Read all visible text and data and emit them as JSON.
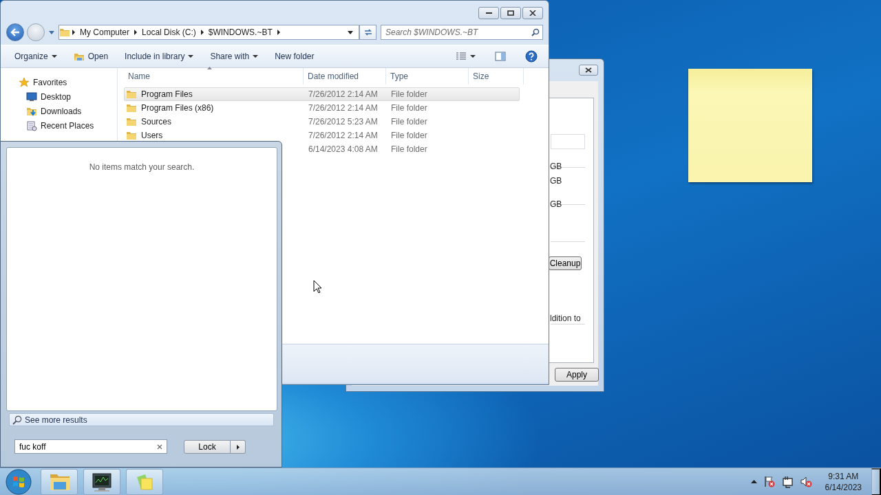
{
  "explorer": {
    "breadcrumb": [
      "My Computer",
      "Local Disk (C:)",
      "$WINDOWS.~BT"
    ],
    "search": {
      "placeholder": "Search $WINDOWS.~BT"
    },
    "toolbar": [
      {
        "label": "Organize",
        "kind": "menu"
      },
      {
        "label": "Open",
        "kind": "open"
      },
      {
        "label": "Include in library",
        "kind": "menu"
      },
      {
        "label": "Share with",
        "kind": "menu"
      },
      {
        "label": "New folder",
        "kind": "plain"
      }
    ],
    "nav": [
      {
        "label": "Favorites",
        "kind": "star",
        "children": [
          {
            "label": "Desktop",
            "kind": "desktop"
          },
          {
            "label": "Downloads",
            "kind": "downloads"
          },
          {
            "label": "Recent Places",
            "kind": "recent"
          }
        ]
      }
    ],
    "columns": [
      "Name",
      "Date modified",
      "Type",
      "Size"
    ],
    "rows": [
      {
        "name": "Program Files",
        "date": "7/26/2012 2:14 AM",
        "type": "File folder",
        "selected": true
      },
      {
        "name": "Program Files (x86)",
        "date": "7/26/2012 2:14 AM",
        "type": "File folder",
        "selected": false
      },
      {
        "name": "Sources",
        "date": "7/26/2012 5:23 AM",
        "type": "File folder",
        "selected": false
      },
      {
        "name": "Users",
        "date": "7/26/2012 2:14 AM",
        "type": "File folder",
        "selected": false
      },
      {
        "date": "6/14/2023 4:08 AM",
        "type": "File folder",
        "selected": false
      }
    ]
  },
  "dialog": {
    "sizes": [
      "GB",
      "GB",
      "GB"
    ],
    "cleanup_button": "Cleanup",
    "note": "ldition to",
    "apply_button": "Apply"
  },
  "start_menu": {
    "empty_message": "No items match your search.",
    "see_more": "See more results",
    "search": {
      "value": "fuc koff"
    },
    "power_button": "Lock"
  },
  "taskbar": {
    "clock": {
      "time": "9:31 AM",
      "date": "6/14/2023"
    }
  }
}
